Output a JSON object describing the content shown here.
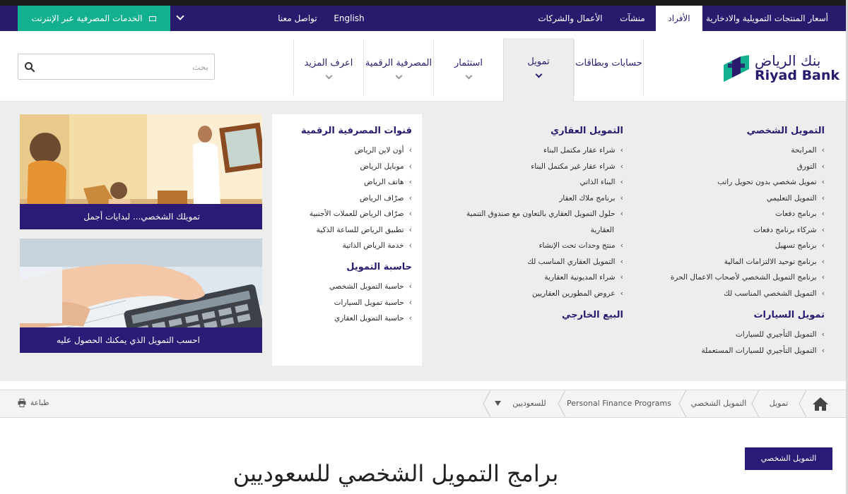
{
  "topbar": {
    "links": [
      "أسعار المنتجات التمويلية والادخارية",
      "الأفراد",
      "منشآت",
      "الأعمال والشركات",
      "English",
      "تواصل معنا"
    ],
    "online_banking": "الخدمات المصرفية عبر الإنترنت"
  },
  "brand": {
    "name_ar": "بنك الرياض",
    "name_en": "Riyad Bank"
  },
  "nav": {
    "tabs": [
      "حسابات وبطاقات",
      "تمويل",
      "استثمار",
      "المصرفية الرقمية",
      "اعرف المزيد"
    ],
    "search_placeholder": "بحث"
  },
  "menu": {
    "personal": {
      "title": "التمويل الشخصي",
      "items": [
        "المرابحة",
        "التورق",
        "تمويل شخصي بدون تحويل راتب",
        "التمويل التعليمي",
        "برنامج دفعات",
        "شركاء برنامج دفعات",
        "برنامج تسهيل",
        "برنامج توحيد الالتزامات المالية",
        "برنامج التمويل الشخصي لأصحاب الاعمال الحرة",
        "التمويل الشخصي المناسب لك"
      ]
    },
    "auto": {
      "title": "تمويل السيارات",
      "items": [
        "التمويل التأجيري للسيارات",
        "التمويل التأجيري للسيارات المستعملة"
      ]
    },
    "real_estate": {
      "title": "التمويل العقاري",
      "items": [
        "شراء عقار مكتمل البناء",
        "شراء عقار غير مكتمل البناء",
        "البناء الذاتي",
        "برنامج ملاك العقار",
        "حلول التمويل العقاري بالتعاون مع صندوق التنمية",
        "العقارية",
        "منتج وحدات تحت الإنشاء",
        "التمويل العقاري المناسب لك",
        "شراء المديونية العقارية",
        "عروض المطورين العقاريين"
      ]
    },
    "sale_back": {
      "title": "البيع الخارجي"
    },
    "digital": {
      "title": "قنوات المصرفية الرقمية",
      "items": [
        "أون لاين الرياض",
        "موبايل الرياض",
        "هاتف الرياض",
        "صرّاف الرياض",
        "صرّاف الرياض للعملات الأجنبية",
        "تطبيق الرياض للساعة الذكية",
        "خدمة الرياض الذاتية"
      ]
    },
    "calculator": {
      "title": "حاسبة التمويل",
      "items": [
        "حاسبة التمويل الشخصي",
        "حاسبة تمويل السيارات",
        "حاسبة التمويل العقاري"
      ]
    }
  },
  "promos": [
    {
      "caption": "تمويلك الشخصي... لبدايات أجمل"
    },
    {
      "caption": "احسب التمويل الذي يمكنك الحصول عليه"
    }
  ],
  "breadcrumb": {
    "items": [
      "تمويل",
      "التمويل الشخصي",
      "Personal Finance Programs",
      "للسعوديين"
    ],
    "print": "طباعة"
  },
  "page": {
    "side_tab": "التمويل الشخصي",
    "title": "برامج التمويل الشخصي للسعوديين"
  },
  "colors": {
    "primary": "#2a1a6e",
    "accent": "#12b08f",
    "menu_bg": "#ededed"
  }
}
